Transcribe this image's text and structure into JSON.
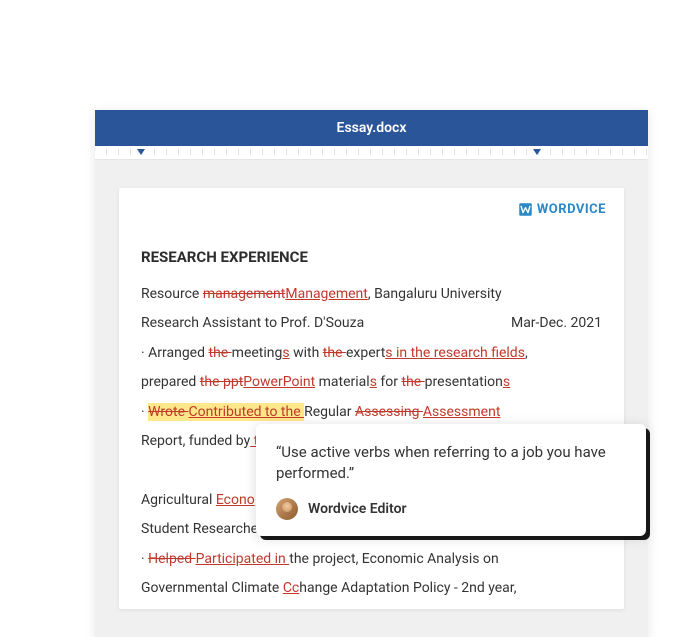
{
  "window": {
    "title": "Essay.docx"
  },
  "logo": {
    "text": "WORDVICE"
  },
  "section_heading": "RESEARCH EXPERIENCE",
  "lines": {
    "l1_pre": "Resource ",
    "l1_del": "management",
    "l1_ins": "Management",
    "l1_post": ", Bangaluru University",
    "l2_left": "Research Assistant to Prof. D'Souza",
    "l2_right": "Mar-Dec. 2021",
    "l3_pre": " · Arranged ",
    "l3_del1": "the ",
    "l3_mid1": "meeting",
    "l3_ins1": "s",
    "l3_mid2": " with ",
    "l3_del2": "the ",
    "l3_mid3": "expert",
    "l3_ins2": "s in the research fields",
    "l3_post": ",",
    "l4_pre": "prepared ",
    "l4_del1": "the ppt",
    "l4_ins1": "PowerPoint",
    "l4_mid1": " material",
    "l4_ins2": "s",
    "l4_mid2": " for ",
    "l4_del2": "the ",
    "l4_mid3": "presentation",
    "l4_ins3": "s",
    "l5_pre": " · ",
    "l5_hl_del": "Wrote ",
    "l5_hl_ins": "Contributed to the ",
    "l5_mid": "Regular ",
    "l5_del": "Assessing ",
    "l5_ins": "Assessment",
    "l6_pre": "Report, funded by",
    "l6_ins": " t",
    "l8_pre": "Agricultural ",
    "l8_ins": "Econo",
    "l9": "Student Researcher",
    "l10_pre": " · ",
    "l10_del": "Helped ",
    "l10_ins": "Participated in ",
    "l10_post": "the   project,  Economic Analysis on",
    "l11_pre": "Governmental Climate ",
    "l11_ins": "Cc",
    "l11_post": "hange Adaptation Policy - 2nd year,"
  },
  "tooltip": {
    "quote": "“Use active verbs when referring to a job you have performed.”",
    "author": "Wordvice Editor"
  }
}
